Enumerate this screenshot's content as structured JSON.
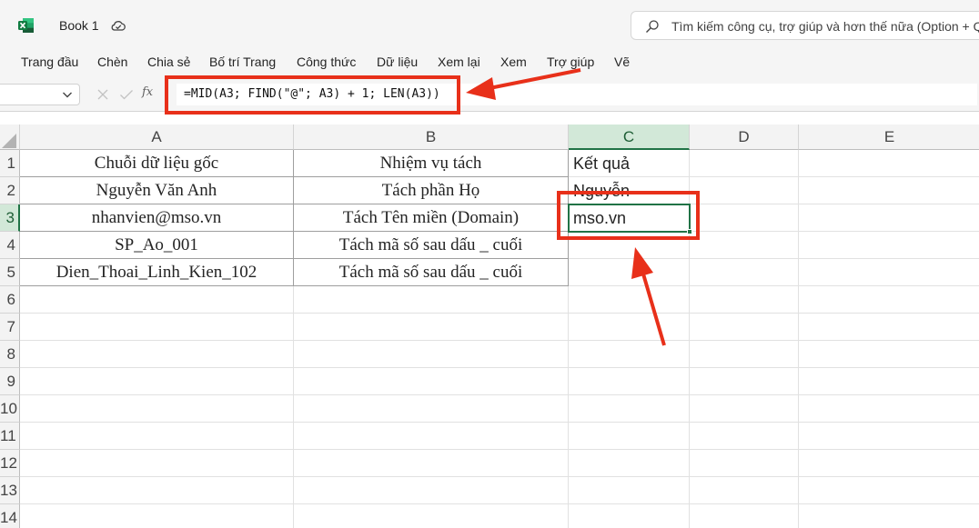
{
  "app": {
    "title": "Book 1",
    "search_placeholder": "Tìm kiếm công cụ, trợ giúp và hơn thế nữa (Option + Q)"
  },
  "ribbon": {
    "tabs": [
      "Trang đầu",
      "Chèn",
      "Chia sẻ",
      "Bố trí Trang",
      "Công thức",
      "Dữ liệu",
      "Xem lại",
      "Xem",
      "Trợ giúp",
      "Vẽ"
    ]
  },
  "formula_bar": {
    "name_box": "",
    "fx_label": "fx",
    "formula": "=MID(A3; FIND(\"@\"; A3) + 1; LEN(A3))"
  },
  "sheet": {
    "columns": [
      "A",
      "B",
      "C",
      "D",
      "E"
    ],
    "rows": [
      "1",
      "2",
      "3",
      "4",
      "5",
      "6",
      "7",
      "8",
      "9",
      "10",
      "11",
      "12",
      "13",
      "14"
    ],
    "active_cell": "C3",
    "cells": {
      "A1": "Chuỗi dữ liệu gốc",
      "B1": "Nhiệm vụ tách",
      "C1": "Kết quả",
      "A2": "Nguyễn Văn Anh",
      "B2": "Tách phần Họ",
      "C2": "Nguyễn",
      "A3": "nhanvien@mso.vn",
      "B3": "Tách Tên miền (Domain)",
      "C3": "mso.vn",
      "A4": "SP_Ao_001",
      "B4": "Tách mã số sau dấu _ cuối",
      "A5": "Dien_Thoai_Linh_Kien_102",
      "B5": "Tách mã số sau dấu _ cuối"
    }
  },
  "colors": {
    "accent": "#217346",
    "annotation": "#e8301a",
    "header_bg": "#f3f3f3",
    "active_header_bg": "#d2e8d8"
  }
}
